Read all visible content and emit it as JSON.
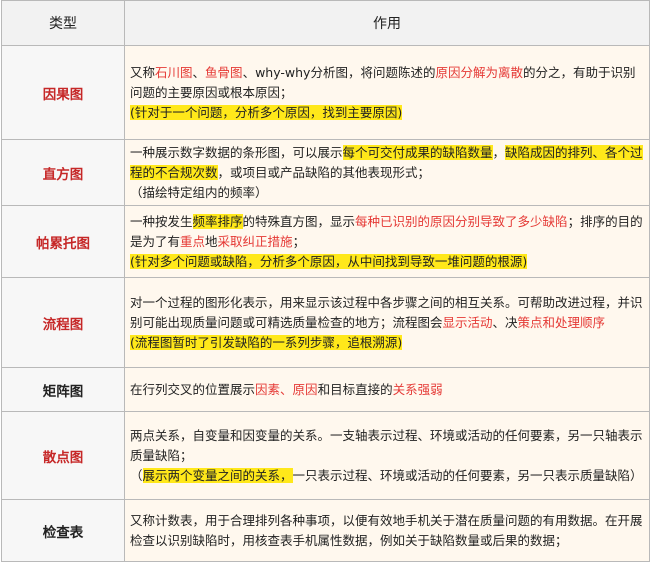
{
  "header": {
    "type": "类型",
    "usage": "作用"
  },
  "rows": [
    {
      "name": "因果图",
      "d": [
        "又称",
        "石川图",
        "、",
        "鱼骨图",
        "、why-why分析图，将问题陈述的",
        "原因分解为离散",
        "的分之，有助于识别问题的主要原因或根本原因；",
        "(针对于一个问题，分析多个原因，找到主要原因)"
      ]
    },
    {
      "name": "直方图",
      "d": [
        "一种展示数字数据的条形图，可以展示",
        "每个可交付成果的缺陷数量",
        "，",
        "缺陷成因的排列、各个过程的不合规次数",
        "，或项目或产品缺陷的其他表现形式；",
        "（描绘特定组内的频率）"
      ]
    },
    {
      "name": "帕累托图",
      "d": [
        "一种按发生",
        "频率排序",
        "的特殊直方图，显示",
        "每种已识别的原因分别导致了多少缺陷",
        "；排序的目的是为了有",
        "重点",
        "地",
        "采取纠正措施",
        "；",
        "(针对多个问题或缺陷，分析多个原因，从中间找到导致一堆问题的根源)"
      ]
    },
    {
      "name": "流程图",
      "d": [
        "对一个过程的图形化表示，用来显示该过程中各步骤之间的相互关系。可帮助改进过程，并识别可能出现质量问题或可精选质量检查的地方；流程图会",
        "显示活动",
        "、决",
        "策点和处理顺序",
        "(流程图暂时了引发缺陷的一系列步骤，追根溯源)"
      ]
    },
    {
      "name": "矩阵图",
      "d": [
        "在行列交叉的位置展示",
        "因素",
        "、",
        "原因",
        "和目标直接的",
        "关系强弱"
      ]
    },
    {
      "name": "散点图",
      "d": [
        "两点关系，自变量和因变量的关系。一支轴表示过程、环境或活动的任何要素，另一只轴表示质量缺陷；",
        "（",
        "展示两个变量之间的关系，",
        "一只表示过程、环境或活动的任何要素，另一只表示质量缺陷）"
      ]
    },
    {
      "name": "检查表",
      "d": [
        "又称计数表，用于合理排列各种事项，以便有效地手机关于潜在质量问题的有用数据。在开展检查以识别缺陷时，用核查表手机属性数据，例如关于缺陷数量或后果的数据；"
      ]
    }
  ]
}
